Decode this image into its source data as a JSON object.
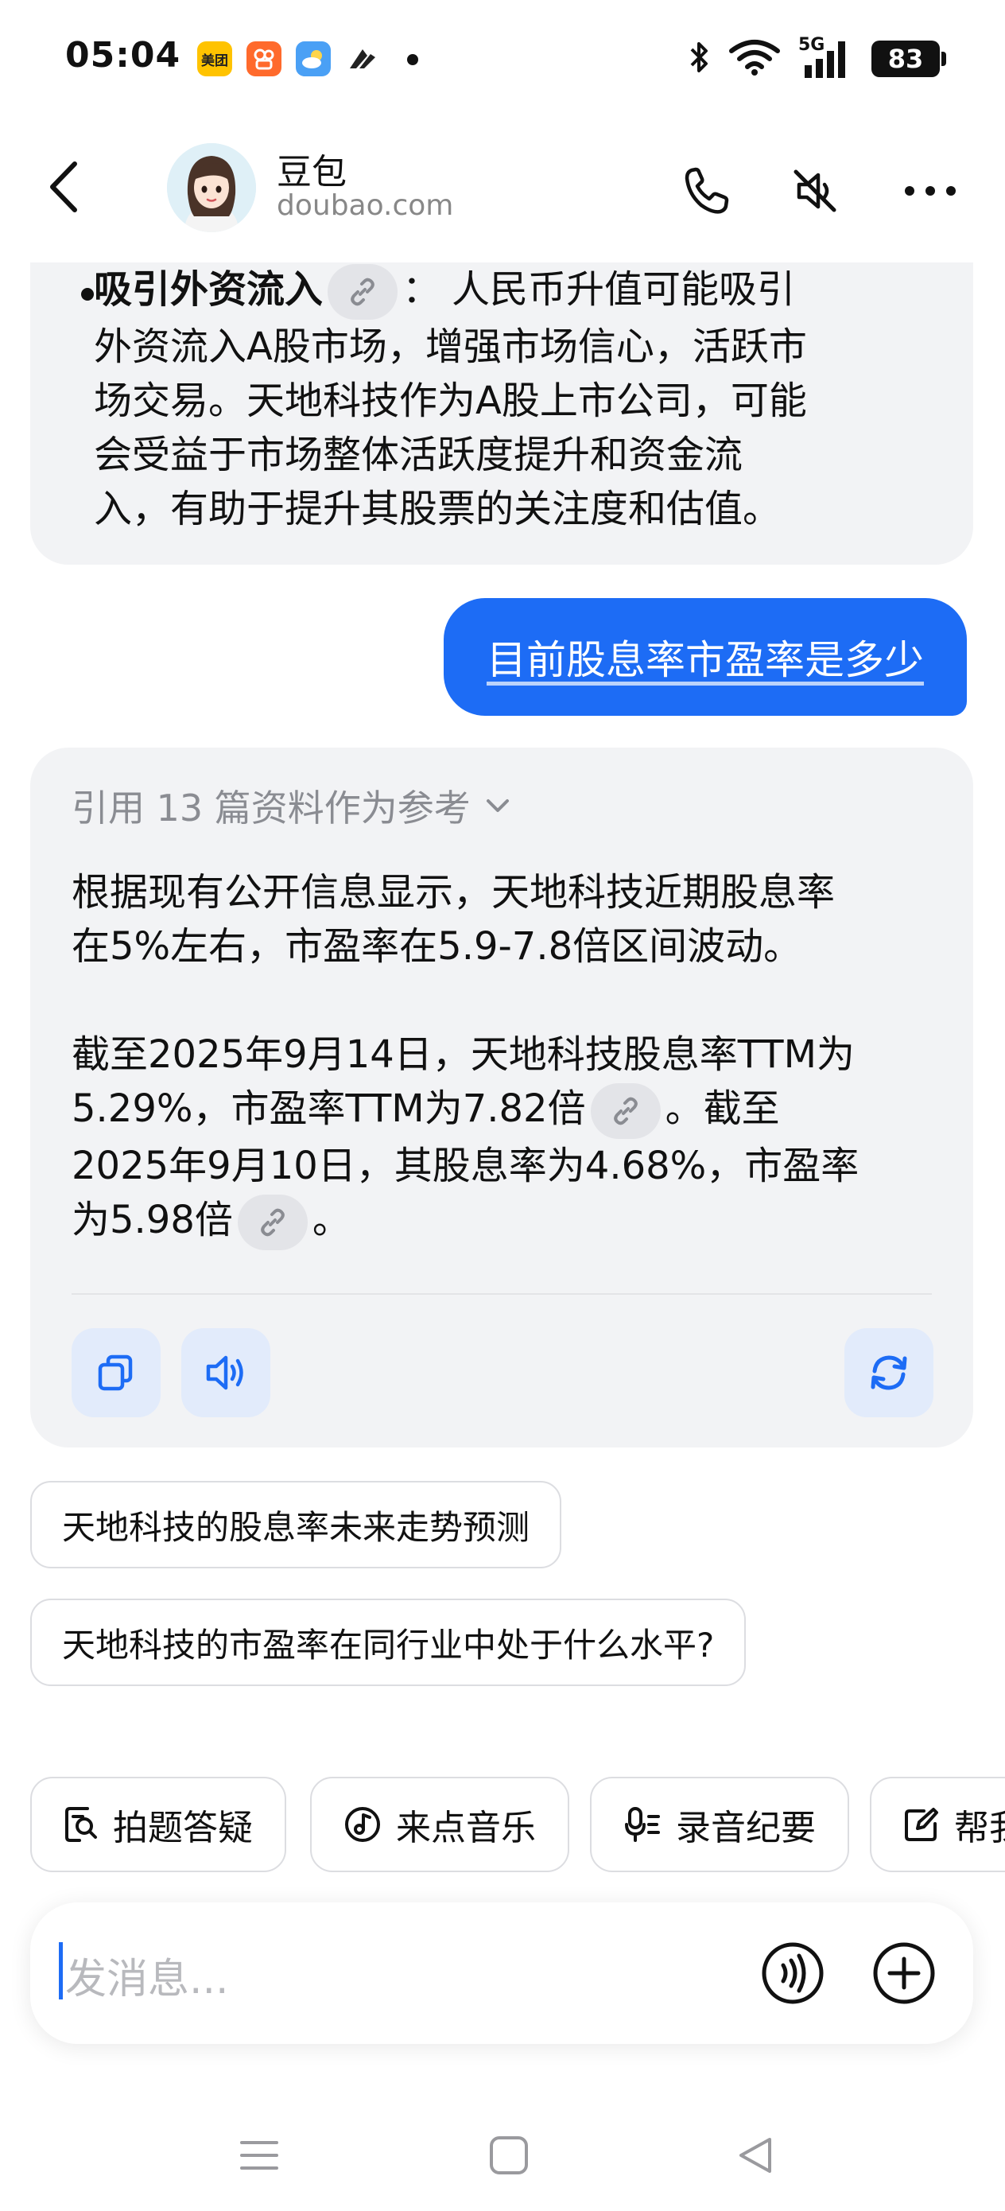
{
  "status_bar": {
    "time": "05:04",
    "app_icons": [
      {
        "name": "meituan-icon",
        "label": "美团",
        "color": "#FFC300"
      },
      {
        "name": "kuaishou-icon",
        "label": "",
        "color": "#FF6A2C"
      },
      {
        "name": "weather-icon",
        "label": "",
        "color": "#4AA0F5"
      },
      {
        "name": "feishu-icon",
        "label": "",
        "color": "#222222"
      }
    ],
    "network": "5G",
    "battery": "83"
  },
  "header": {
    "bot_name": "豆包",
    "bot_domain": "doubao.com",
    "icons": [
      "back-arrow-icon",
      "phone-icon",
      "speaker-muted-icon",
      "more-icon"
    ]
  },
  "chat": {
    "previous_bullet": {
      "title": "吸引外资流入",
      "separator": "：",
      "line1_rest": "人民币升值可能吸引",
      "lines": [
        "外资流入A股市场，增强市场信心，活跃市",
        "场交易。天地科技作为A股上市公司，可能",
        "会受益于市场整体活跃度提升和资金流",
        "入，有助于提升其股票的关注度和估值。"
      ]
    },
    "user_message": "目前股息率市盈率是多少",
    "ai_reply": {
      "reference": "引用 13 篇资料作为参考",
      "para1": [
        "根据现有公开信息显示，天地科技近期股息率",
        "在5%左右，市盈率在5.9-7.8倍区间波动。"
      ],
      "para2_line1": "截至2025年9月14日，天地科技股息率TTM为",
      "para2_line2_a": "5.29%，市盈率TTM为7.82倍",
      "para2_line2_b": "。截至",
      "para2_line3": "2025年9月10日，其股息率为4.68%，市盈率",
      "para2_line4_a": "为5.98倍",
      "para2_line4_b": "。"
    },
    "suggestions": [
      "天地科技的股息率未来走势预测",
      "天地科技的市盈率在同行业中处于什么水平?"
    ]
  },
  "tools": [
    {
      "label": "拍题答疑",
      "icon": "photo-question-icon"
    },
    {
      "label": "来点音乐",
      "icon": "music-icon"
    },
    {
      "label": "录音纪要",
      "icon": "recording-icon"
    },
    {
      "label": "帮我",
      "icon": "edit-icon"
    }
  ],
  "input": {
    "placeholder": "发消息..."
  },
  "colors": {
    "accent": "#1D6CF5",
    "bubble_bg": "#F2F3F5",
    "action_btn_bg": "#E2EBFB"
  }
}
